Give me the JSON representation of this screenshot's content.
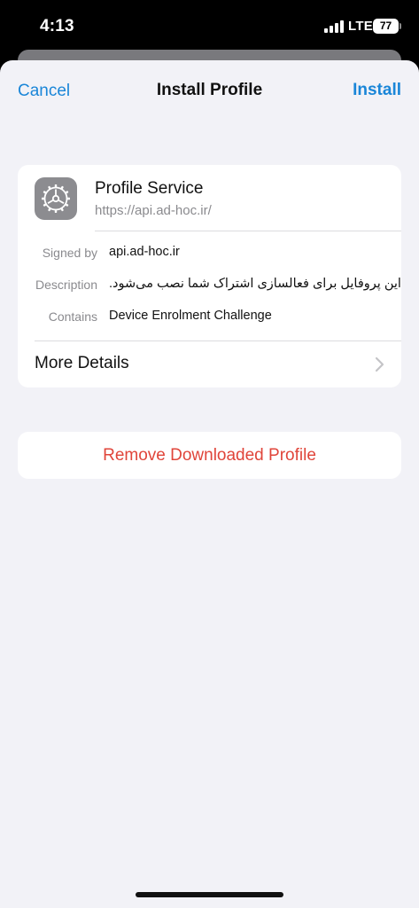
{
  "status_bar": {
    "time": "4:13",
    "network": "LTE",
    "battery": "77"
  },
  "nav": {
    "cancel_label": "Cancel",
    "title": "Install Profile",
    "install_label": "Install"
  },
  "profile": {
    "icon": "gear-icon",
    "name": "Profile Service",
    "url": "https://api.ad-hoc.ir/",
    "rows": [
      {
        "label": "Signed by",
        "value": "api.ad-hoc.ir"
      },
      {
        "label": "Description",
        "value": "این پروفایل برای فعالسازی اشتراک شما نصب می‌شود."
      },
      {
        "label": "Contains",
        "value": "Device Enrolment Challenge"
      }
    ],
    "more_details_label": "More Details"
  },
  "remove": {
    "label": "Remove Downloaded Profile"
  },
  "colors": {
    "accent": "#1a86d8",
    "destructive": "#e0453a",
    "background": "#f2f2f7"
  }
}
